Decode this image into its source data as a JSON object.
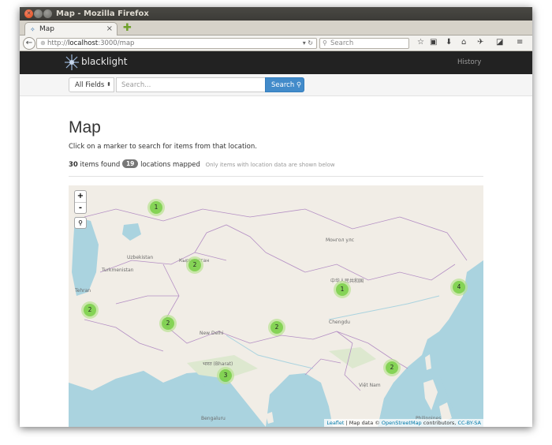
{
  "window": {
    "title": "Map - Mozilla Firefox",
    "tab_label": "Map"
  },
  "browser": {
    "url_prefix": "http://",
    "url_host": "localhost",
    "url_rest": ":3000/map",
    "search_placeholder": "Search"
  },
  "header": {
    "brand": "blacklight",
    "nav_history": "History"
  },
  "search": {
    "field_selected": "All Fields",
    "query_placeholder": "Search...",
    "button_label": "Search"
  },
  "main": {
    "title": "Map",
    "instructions": "Click on a marker to search for items from that location.",
    "items_count": "30",
    "items_found_text": "items found",
    "locations_count": "19",
    "locations_text": "locations mapped",
    "note": "Only items with location data are shown below"
  },
  "map": {
    "zoom_in": "+",
    "zoom_out": "-",
    "clusters": [
      {
        "count": "1"
      },
      {
        "count": "2"
      },
      {
        "count": "2"
      },
      {
        "count": "2"
      },
      {
        "count": "2"
      },
      {
        "count": "1"
      },
      {
        "count": "4"
      },
      {
        "count": "3"
      },
      {
        "count": "2"
      }
    ],
    "labels": {
      "uzbekistan": "Uzbekistan",
      "turkmenistan": "Turkmenistan",
      "kyrgyzstan": "Кыргызстан",
      "china": "中华人民共和国",
      "mongolia": "Монгол улс",
      "india": "भारत (Bharat)",
      "new_delhi": "New Delhi",
      "chengdu": "Chengdu",
      "viet_nam": "Việt Nam",
      "philippines": "Philippines",
      "bengaluru": "Bengaluru",
      "tehran": "Tehran"
    },
    "attribution_leaflet": "Leaflet",
    "attribution_mid": "| Map data ©",
    "attribution_osm": "OpenStreetMap",
    "attribution_contrib": "contributors,",
    "attribution_license": "CC-BY-SA"
  }
}
